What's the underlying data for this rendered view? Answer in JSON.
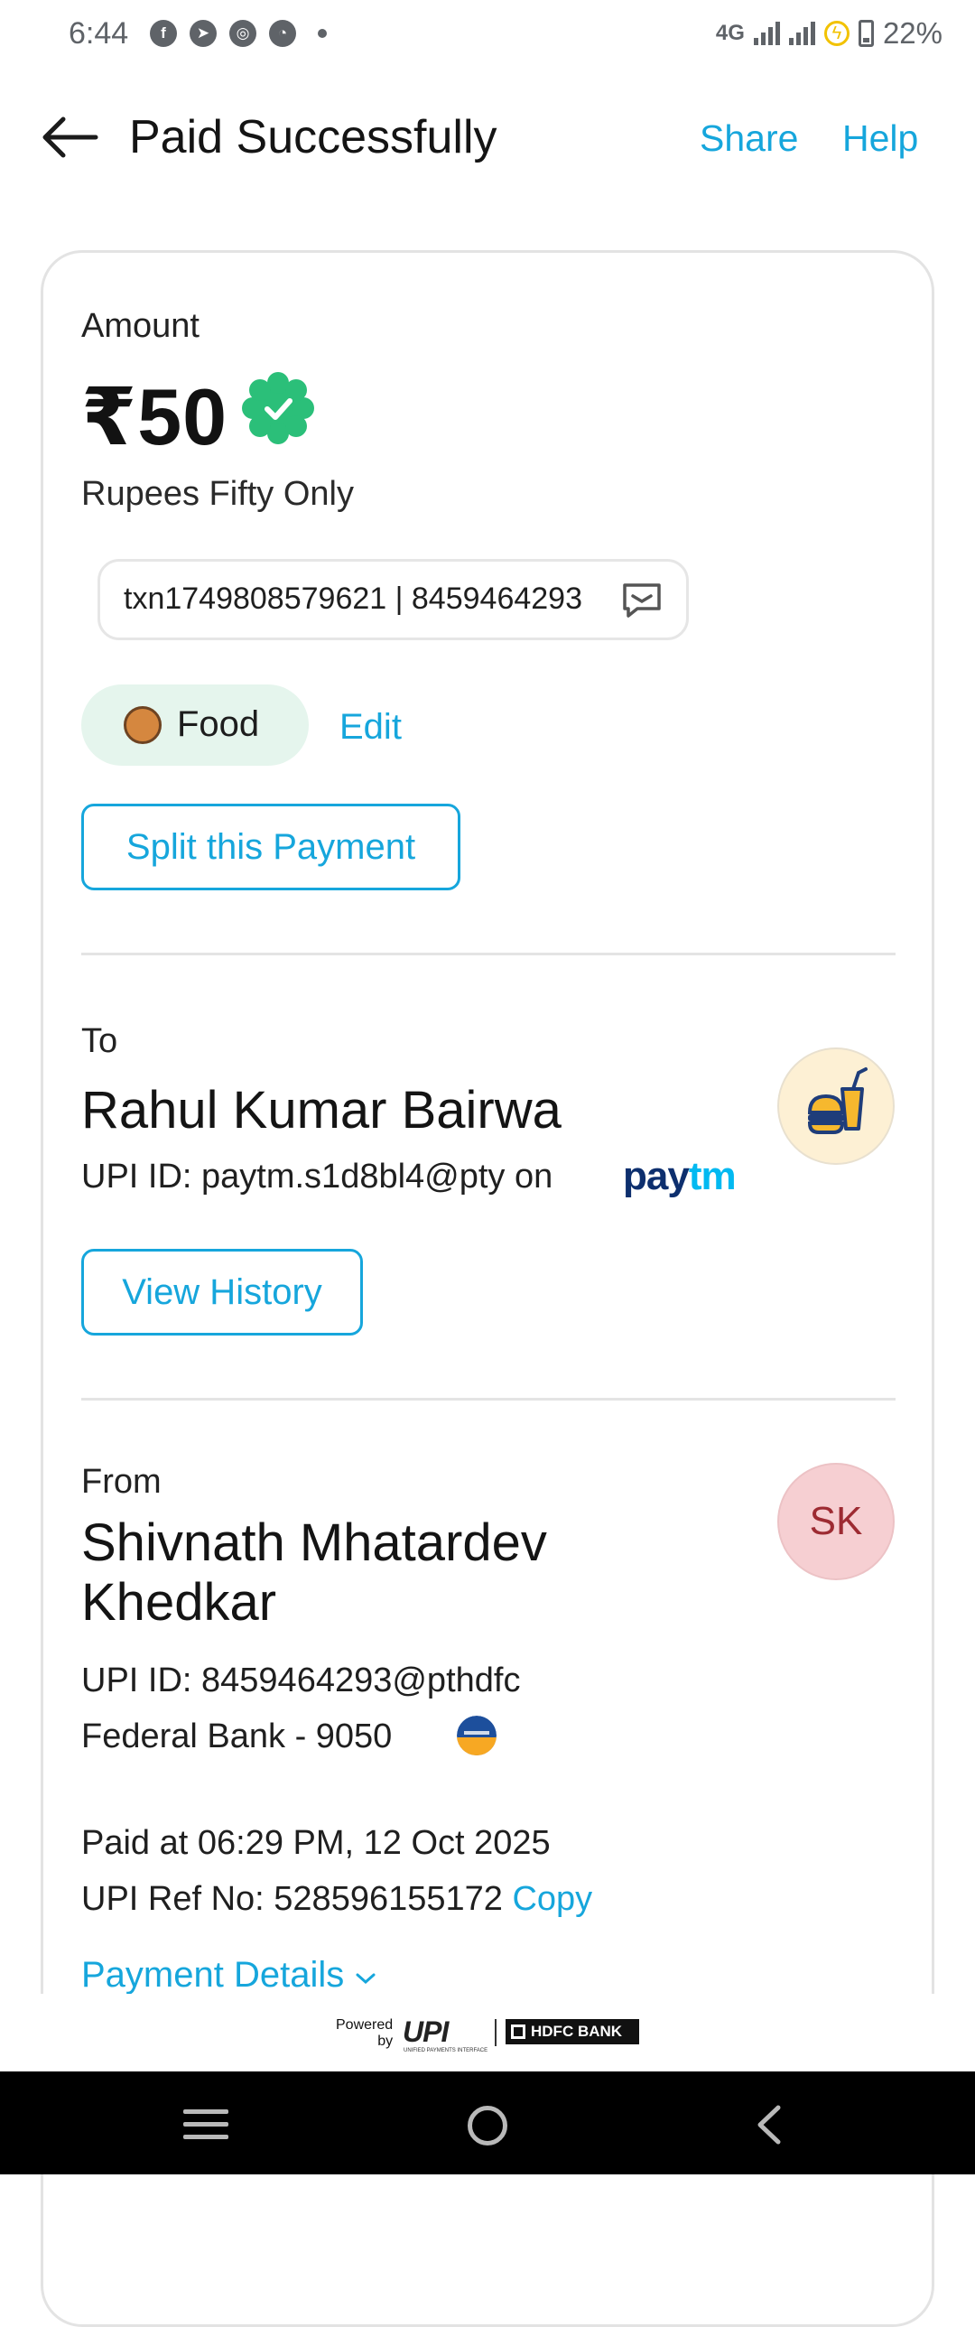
{
  "status_bar": {
    "time": "6:44",
    "network": "4G",
    "battery": "22%",
    "battery_level": 0.22,
    "left_icons": [
      "facebook-icon",
      "telegram-icon",
      "instagram-icon",
      "speed-icon"
    ]
  },
  "header": {
    "title": "Paid Successfully",
    "share": "Share",
    "help": "Help"
  },
  "amount": {
    "label": "Amount",
    "value": "₹50",
    "words": "Rupees Fifty Only",
    "verified_color": "#2bbf79"
  },
  "note": {
    "text": "txn1749808579621 | 8459464293"
  },
  "category": {
    "label": "Food",
    "edit": "Edit"
  },
  "split_button": "Split this Payment",
  "to": {
    "label": "To",
    "name": "Rahul Kumar Bairwa",
    "upi": "UPI ID: paytm.s1d8bl4@pty on",
    "app_pay": "pay",
    "app_tm": "tm",
    "history_button": "View History"
  },
  "from": {
    "label": "From",
    "name": "Shivnath Mhatardev Khedkar",
    "initials": "SK",
    "upi": "UPI ID: 8459464293@pthdfc",
    "bank": "Federal Bank - 9050"
  },
  "details": {
    "paid_at": "Paid at 06:29 PM, 12 Oct 2025",
    "ref_label": "UPI Ref No: 528596155172",
    "copy": "Copy",
    "payment_details": "Payment Details"
  },
  "footer": {
    "powered": "Powered",
    "by": "by",
    "upi": "UPI",
    "upi_sub": "UNIFIED PAYMENTS INTERFACE",
    "bank": "HDFC BANK"
  },
  "colors": {
    "accent": "#16a6dc",
    "success": "#2bbf79"
  }
}
